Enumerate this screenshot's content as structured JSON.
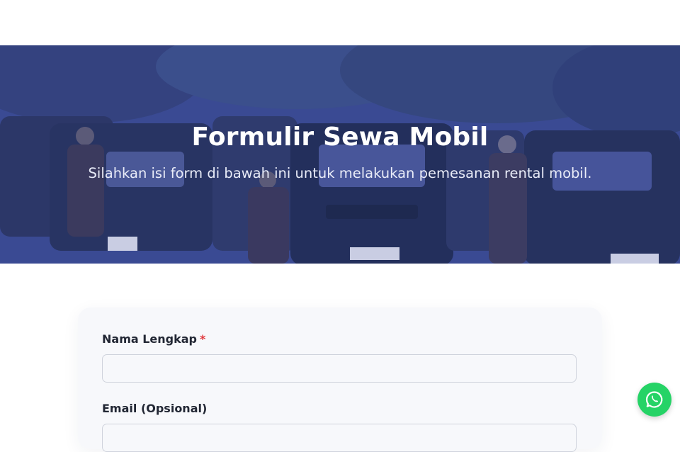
{
  "hero": {
    "title": "Formulir Sewa Mobil",
    "subtitle": "Silahkan isi form di bawah ini untuk melakukan pemesanan rental mobil.",
    "overlay_color": "#39488f"
  },
  "form": {
    "fields": [
      {
        "label": "Nama Lengkap",
        "required_mark": "*",
        "value": "",
        "placeholder": ""
      },
      {
        "label": "Email (Opsional)",
        "value": "",
        "placeholder": ""
      }
    ]
  },
  "floating": {
    "icon": "whatsapp-icon",
    "color": "#25d366"
  },
  "colors": {
    "required": "#e0373b",
    "label": "#222734"
  }
}
